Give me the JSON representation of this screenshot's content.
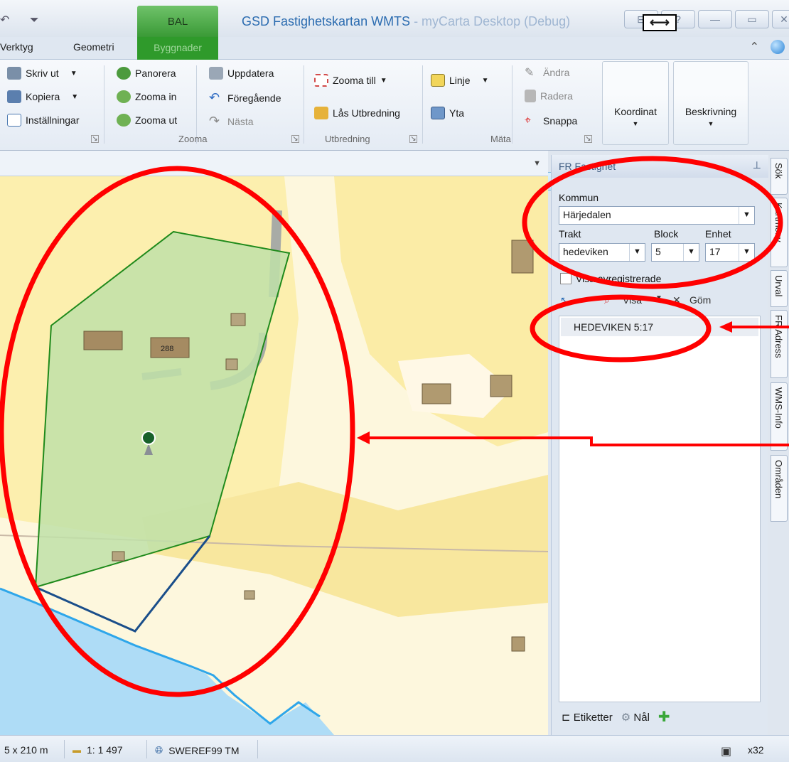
{
  "titlebar": {
    "qat_icons": [
      "undo-icon",
      "customize-qat-icon"
    ],
    "context_tab_group": "BAL",
    "title_main": "GSD Fastighetskartan WMTS",
    "title_suffix": " - myCarta Desktop (Debug)"
  },
  "tabs": {
    "verktyg": "Verktyg",
    "geometri": "Geometri",
    "byggnader": "Byggnader"
  },
  "ribbon": {
    "print": "Skriv ut",
    "copy": "Kopiera",
    "settings": "Inställningar",
    "pan": "Panorera",
    "zoom_in": "Zooma in",
    "zoom_out": "Zooma ut",
    "zoom_group": "Zooma",
    "refresh": "Uppdatera",
    "previous": "Föregående",
    "next": "Nästa",
    "zoom_to": "Zooma till",
    "lock_extent": "Lås Utbredning",
    "extent_group": "Utbredning",
    "line": "Linje",
    "area": "Yta",
    "edit": "Ändra",
    "delete": "Radera",
    "snap": "Snappa",
    "measure_group": "Mäta",
    "coordinate": "Koordinat",
    "description": "Beskrivning"
  },
  "panel": {
    "title": "FR Fastighet",
    "kommun_label": "Kommun",
    "kommun_value": "Härjedalen",
    "trakt_label": "Trakt",
    "block_label": "Block",
    "enhet_label": "Enhet",
    "trakt_value": "hedeviken",
    "block_value": "5",
    "enhet_value": "17",
    "show_deregistered": "Visa avregistrerade",
    "show_button": "Visa",
    "hide_button": "Göm",
    "results": [
      "HEDEVIKEN 5:17"
    ],
    "labels_button": "Etiketter",
    "pin_button": "Nål"
  },
  "vertical_tabs": [
    "Sök",
    "Kartmeny",
    "Urval",
    "FR Adress",
    "WMS-Info",
    "Områden"
  ],
  "map": {
    "building_label": "288"
  },
  "statusbar": {
    "extent": "5 x 210 m",
    "scale": "1: 1 497",
    "crs": "SWEREF99 TM",
    "zoom_factor": "x32"
  },
  "colors": {
    "context_tab": "#2f9a2b",
    "parcel_fill": "#bfe0a8",
    "parcel_stroke": "#1f8a1b",
    "annotation": "#ff0000",
    "water": "#a9d9f7"
  }
}
